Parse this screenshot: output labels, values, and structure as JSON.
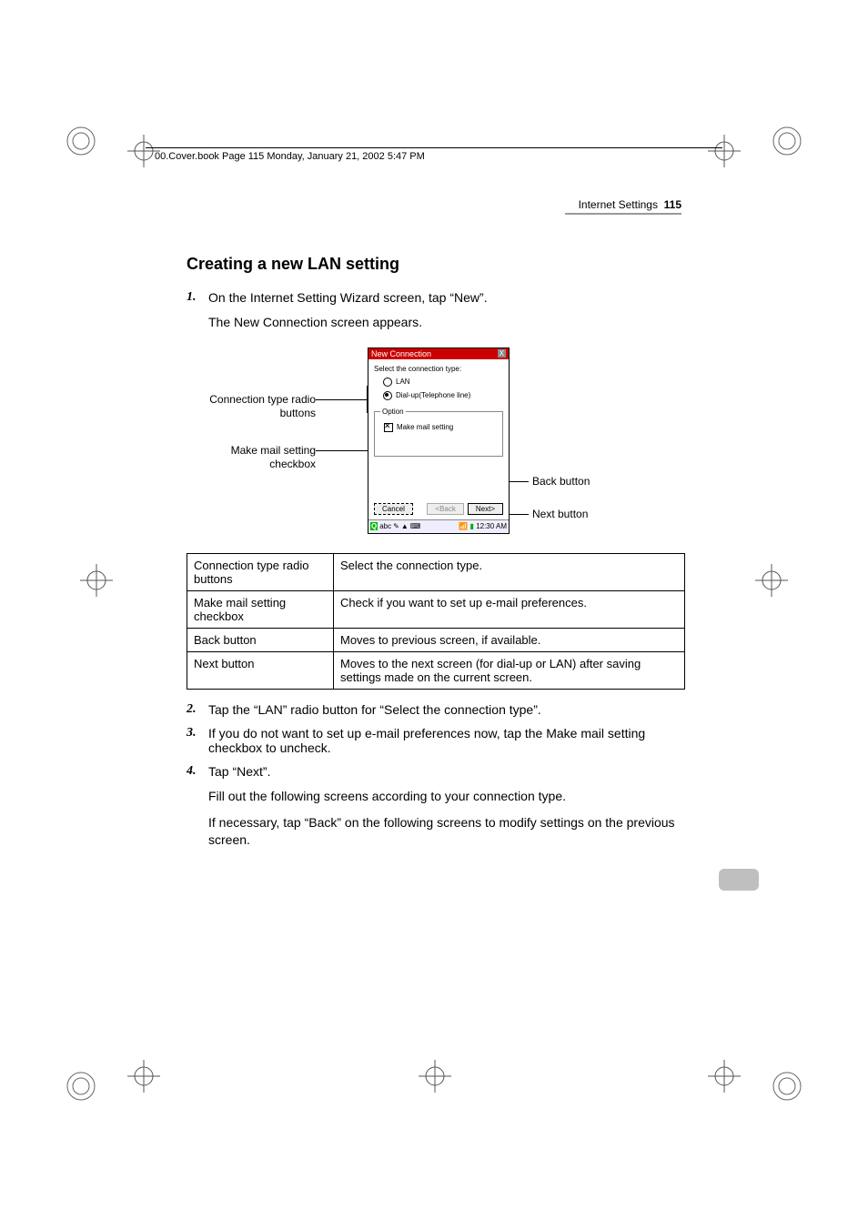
{
  "print_header": "00.Cover.book  Page 115  Monday, January 21, 2002  5:47 PM",
  "running_head": {
    "section": "Internet Settings",
    "page": "115"
  },
  "heading": "Creating a new LAN setting",
  "steps": {
    "s1_num": "1.",
    "s1": "On the Internet Setting Wizard screen, tap “New”.",
    "s1_sub": "The New Connection screen appears.",
    "s2_num": "2.",
    "s2": "Tap the “LAN” radio button for “Select the connection type”.",
    "s3_num": "3.",
    "s3": "If you do not want to set up e-mail preferences now, tap the Make mail setting checkbox to uncheck.",
    "s4_num": "4.",
    "s4": "Tap “Next”.",
    "s4_sub1": "Fill out the following screens according to your connection type.",
    "s4_sub2": "If necessary, tap “Back” on the following screens to modify settings on the previous screen."
  },
  "callouts": {
    "conn_type": "Connection type radio buttons",
    "make_mail": "Make mail setting checkbox",
    "back_btn": "Back button",
    "next_btn": "Next button"
  },
  "pda": {
    "title": "New Connection",
    "prompt": "Select the connection type:",
    "opt_lan": "LAN",
    "opt_dialup": "Dial-up(Telephone line)",
    "option_legend": "Option",
    "make_mail": "Make mail setting",
    "cancel": "Cancel",
    "back": "<Back",
    "next": "Next>",
    "status_left": "abc",
    "status_time": "12:30 AM"
  },
  "table": {
    "r1c1": "Connection type radio buttons",
    "r1c2": "Select the connection type.",
    "r2c1": "Make mail setting checkbox",
    "r2c2": "Check if you want to set up e-mail preferences.",
    "r3c1": "Back button",
    "r3c2": "Moves to previous screen, if available.",
    "r4c1": "Next button",
    "r4c2": "Moves to the next screen (for dial-up or LAN) after saving settings made on the current screen."
  }
}
